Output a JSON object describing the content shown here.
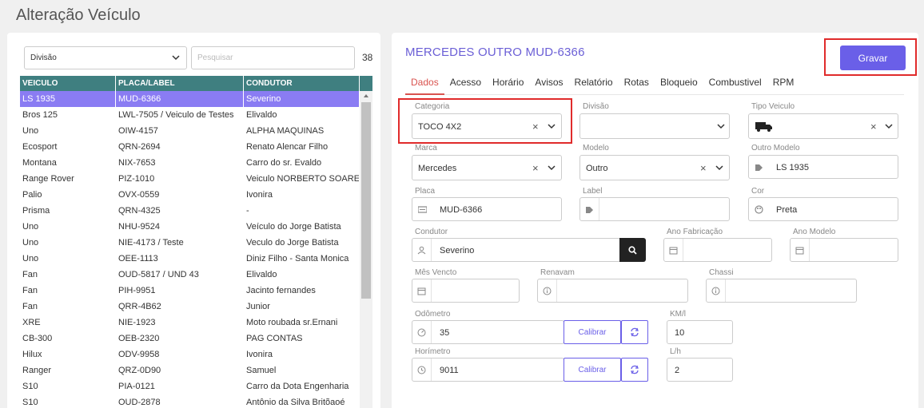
{
  "page_title": "Alteração Veículo",
  "list": {
    "division_select": "Divisão",
    "search_placeholder": "Pesquisar",
    "count": "38",
    "columns": [
      "VEICULO",
      "PLACA/LABEL",
      "CONDUTOR"
    ],
    "rows": [
      [
        "LS 1935",
        "MUD-6366",
        "Severino"
      ],
      [
        "Bros 125",
        "LWL-7505 / Veiculo de Testes",
        "Elivaldo"
      ],
      [
        "Uno",
        "OIW-4157",
        "ALPHA MAQUINAS"
      ],
      [
        "Ecosport",
        "QRN-2694",
        "Renato Alencar Filho"
      ],
      [
        "Montana",
        "NIX-7653",
        "Carro do sr. Evaldo"
      ],
      [
        "Range Rover",
        "PIZ-1010",
        "Veiculo NORBERTO SOARES"
      ],
      [
        "Palio",
        "OVX-0559",
        "Ivonira"
      ],
      [
        "Prisma",
        "QRN-4325",
        "-"
      ],
      [
        "Uno",
        "NHU-9524",
        "Veículo do Jorge Batista"
      ],
      [
        "Uno",
        "NIE-4173 / Teste",
        "Veculo do Jorge Batista"
      ],
      [
        "Uno",
        "OEE-1113",
        "Diniz Filho - Santa Monica"
      ],
      [
        "Fan",
        "OUD-5817 / UND 43",
        "Elivaldo"
      ],
      [
        "Fan",
        "PIH-9951",
        "Jacinto fernandes"
      ],
      [
        "Fan",
        "QRR-4B62",
        "Junior"
      ],
      [
        "XRE",
        "NIE-1923",
        "Moto roubada sr.Ernani"
      ],
      [
        "CB-300",
        "OEB-2320",
        "PAG CONTAS"
      ],
      [
        "Hilux",
        "ODV-9958",
        "Ivonira"
      ],
      [
        "Ranger",
        "QRZ-0D90",
        "Samuel"
      ],
      [
        "S10",
        "PIA-0121",
        "Carro da Dota Engenharia"
      ],
      [
        "S10",
        "OUD-2878",
        "Antônio da Silva Britõaoé"
      ]
    ],
    "selected_index": 0
  },
  "detail": {
    "title": "MERCEDES OUTRO MUD-6366",
    "save_label": "Gravar",
    "tabs": [
      "Dados",
      "Acesso",
      "Horário",
      "Avisos",
      "Relatório",
      "Rotas",
      "Bloqueio",
      "Combustivel",
      "RPM"
    ],
    "active_tab": 0,
    "fields": {
      "categoria": {
        "label": "Categoria",
        "value": "TOCO 4X2"
      },
      "divisao": {
        "label": "Divisão",
        "value": ""
      },
      "tipo_veiculo": {
        "label": "Tipo Veiculo",
        "icon": "truck-icon"
      },
      "marca": {
        "label": "Marca",
        "value": "Mercedes"
      },
      "modelo": {
        "label": "Modelo",
        "value": "Outro"
      },
      "outro_modelo": {
        "label": "Outro Modelo",
        "value": "LS 1935"
      },
      "placa": {
        "label": "Placa",
        "value": "MUD-6366"
      },
      "label": {
        "label": "Label",
        "value": ""
      },
      "cor": {
        "label": "Cor",
        "value": "Preta"
      },
      "condutor": {
        "label": "Condutor",
        "value": "Severino"
      },
      "ano_fabricacao": {
        "label": "Ano Fabricação",
        "value": ""
      },
      "ano_modelo": {
        "label": "Ano Modelo",
        "value": ""
      },
      "mes_vencto": {
        "label": "Mês Vencto",
        "value": ""
      },
      "renavam": {
        "label": "Renavam",
        "value": ""
      },
      "chassi": {
        "label": "Chassi",
        "value": ""
      },
      "odometro": {
        "label": "Odômetro",
        "value": "35"
      },
      "km_l": {
        "label": "KM/l",
        "value": "10"
      },
      "horimetro": {
        "label": "Horímetro",
        "value": "9011"
      },
      "l_h": {
        "label": "L/h",
        "value": "2"
      }
    },
    "calibrar_label": "Calibrar"
  },
  "colors": {
    "accent": "#6a5fe8",
    "header_teal": "#3f7f80",
    "selected_row": "#8a7cf3",
    "highlight_red": "#e02b2b",
    "tab_active": "#d9534f"
  }
}
